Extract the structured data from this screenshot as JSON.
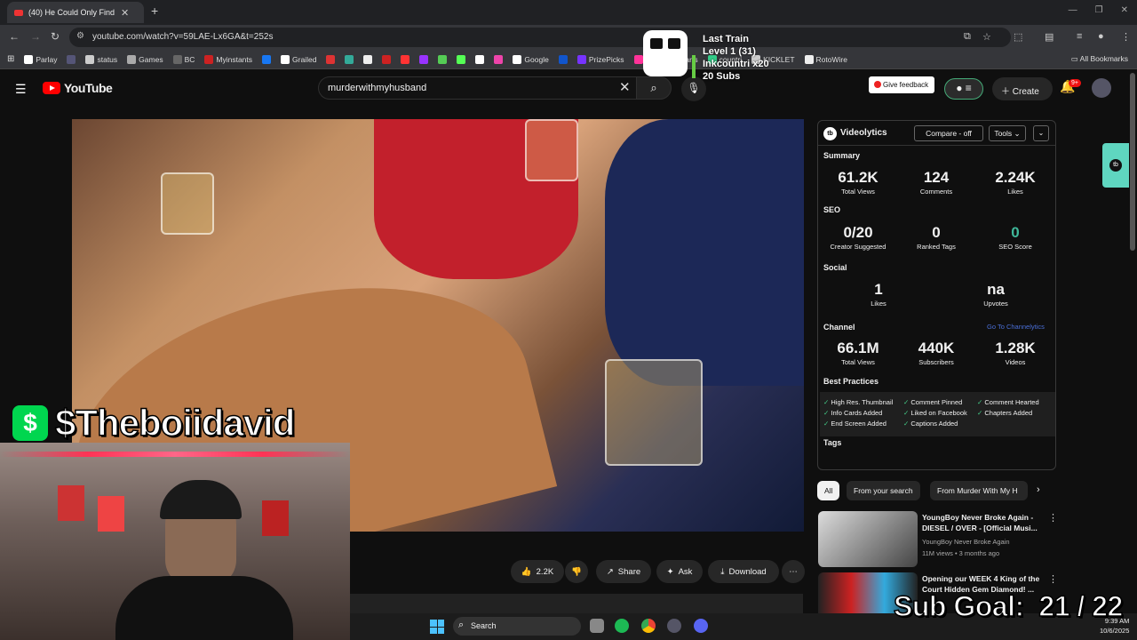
{
  "browser": {
    "tab_title": "(40) He Could Only Find On",
    "url": "youtube.com/watch?v=59LAE-Lx6GA&t=252s",
    "bookmarks": [
      {
        "label": "Parlay",
        "color": "#fff"
      },
      {
        "label": "",
        "color": "#557"
      },
      {
        "label": "status",
        "color": "#ccc"
      },
      {
        "label": "Games",
        "color": "#aaa"
      },
      {
        "label": "BC",
        "color": "#666"
      },
      {
        "label": "Myinstants",
        "color": "#c22"
      },
      {
        "label": "",
        "color": "#1877f2"
      },
      {
        "label": "Grailed",
        "color": "#fff"
      },
      {
        "label": "",
        "color": "#d33"
      },
      {
        "label": "",
        "color": "#3a9"
      },
      {
        "label": "",
        "color": "#eee"
      },
      {
        "label": "",
        "color": "#c22"
      },
      {
        "label": "",
        "color": "#f33"
      },
      {
        "label": "",
        "color": "#93f"
      },
      {
        "label": "",
        "color": "#5c5"
      },
      {
        "label": "",
        "color": "#5f5"
      },
      {
        "label": "",
        "color": "#fff"
      },
      {
        "label": "",
        "color": "#e4a"
      },
      {
        "label": "Google",
        "color": "#fff"
      },
      {
        "label": "",
        "color": "#15c"
      },
      {
        "label": "PrizePicks",
        "color": "#73f"
      },
      {
        "label": "Streams Charts",
        "color": "#f39"
      },
      {
        "label": "countri",
        "color": "#3c8"
      },
      {
        "label": "KICKLET",
        "color": "#ccc"
      },
      {
        "label": "RotoWire",
        "color": "#eee"
      }
    ],
    "all_bookmarks": "All Bookmarks"
  },
  "overlay": {
    "train_title": "Last Train",
    "train_level": "Level 1  (31)",
    "train_user": "Inkcountri x20",
    "train_subs": "20 Subs",
    "cashtag": "$Theboiidavid",
    "cash_symbol": "$",
    "sub_goal": "Sub Goal:  21 / 22"
  },
  "youtube": {
    "logo": "YouTube",
    "search_value": "murderwithmyhusband",
    "feedback": "Give feedback",
    "create": "Create",
    "notif_count": "9+",
    "actions": {
      "likes": "2.2K",
      "share": "Share",
      "ask": "Ask",
      "download": "Download"
    }
  },
  "videolytics": {
    "title": "Videolytics",
    "compare": "Compare - off",
    "tools": "Tools",
    "summary_label": "Summary",
    "summary": [
      {
        "n": "61.2K",
        "l": "Total Views"
      },
      {
        "n": "124",
        "l": "Comments"
      },
      {
        "n": "2.24K",
        "l": "Likes"
      }
    ],
    "seo_label": "SEO",
    "seo": [
      {
        "n": "0/20",
        "l": "Creator Suggested"
      },
      {
        "n": "0",
        "l": "Ranked Tags"
      },
      {
        "n": "0",
        "l": "SEO Score"
      }
    ],
    "social_label": "Social",
    "social": [
      {
        "n": "1",
        "l": "Likes"
      },
      {
        "n": "na",
        "l": "Upvotes"
      }
    ],
    "channel_label": "Channel",
    "channel_link": "Go To Channelytics",
    "channel": [
      {
        "n": "66.1M",
        "l": "Total Views"
      },
      {
        "n": "440K",
        "l": "Subscribers"
      },
      {
        "n": "1.28K",
        "l": "Videos"
      }
    ],
    "bp_label": "Best Practices",
    "bp": [
      "High Res. Thumbnail",
      "Comment Pinned",
      "Comment Hearted",
      "Info Cards Added",
      "Liked on Facebook",
      "Chapters Added",
      "End Screen Added",
      "Captions Added"
    ],
    "tags_label": "Tags"
  },
  "chips": [
    "All",
    "From your search",
    "From Murder With My H"
  ],
  "recs": [
    {
      "title": "YoungBoy Never Broke Again - DIESEL / OVER - [Official Musi...",
      "channel": "YoungBoy Never Broke Again",
      "meta": "11M views • 3 months ago"
    },
    {
      "title": "Opening our WEEK 4 King of the Court Hidden Gem Diamond! ...",
      "channel": "",
      "meta": ""
    }
  ],
  "taskbar": {
    "search": "Search",
    "time": "9:39 AM",
    "date": "10/6/2025"
  }
}
